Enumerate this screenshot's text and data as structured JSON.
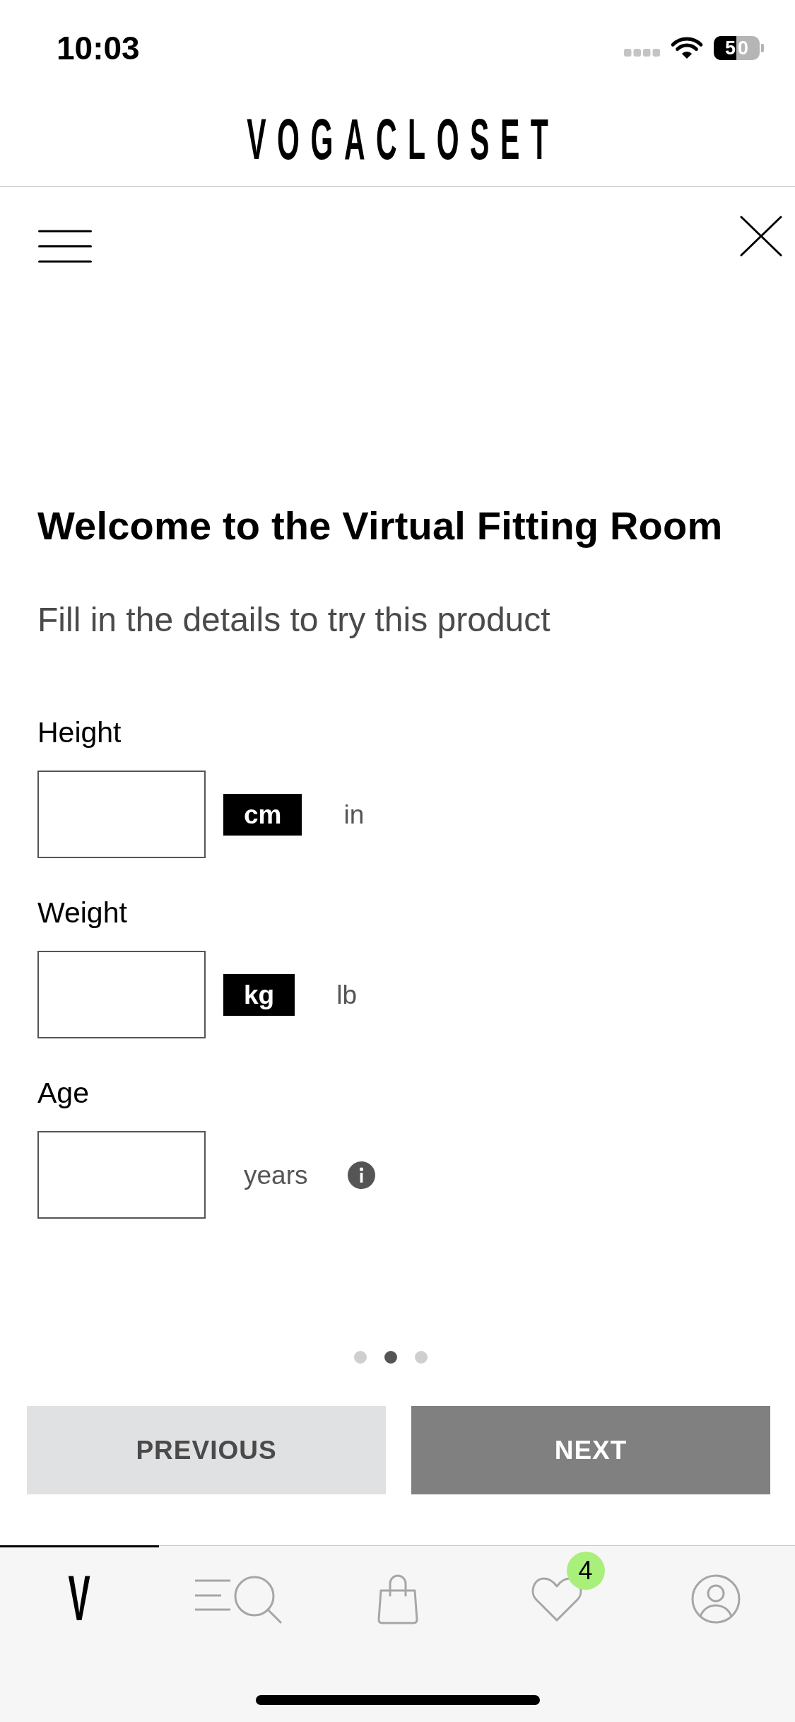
{
  "status_bar": {
    "time": "10:03",
    "battery": "50"
  },
  "header": {
    "logo": "VOGACLOSET"
  },
  "dialog": {
    "title": "Welcome to the Virtual Fitting Room",
    "subtitle": "Fill in the details to try this product",
    "fields": [
      {
        "label": "Height",
        "kind": "units",
        "units": [
          {
            "label": "cm",
            "selected": true
          },
          {
            "label": "in",
            "selected": false
          }
        ]
      },
      {
        "label": "Weight",
        "kind": "units",
        "units": [
          {
            "label": "kg",
            "selected": true
          },
          {
            "label": "lb",
            "selected": false
          }
        ]
      },
      {
        "label": "Age",
        "kind": "suffix",
        "suffix": "years",
        "info": true
      }
    ],
    "pages": [
      {
        "selected": false
      },
      {
        "selected": true
      },
      {
        "selected": false
      }
    ],
    "buttons": [
      {
        "label": "PREVIOUS",
        "kind": "secondary"
      },
      {
        "label": "NEXT",
        "kind": "primary"
      }
    ]
  },
  "tab_bar": [
    {
      "kind": "logo",
      "label": "V",
      "selected": true
    },
    {
      "kind": "search",
      "selected": false
    },
    {
      "kind": "bag",
      "selected": false
    },
    {
      "kind": "wishlist",
      "badge": "4",
      "selected": false
    },
    {
      "kind": "account",
      "selected": false
    }
  ]
}
